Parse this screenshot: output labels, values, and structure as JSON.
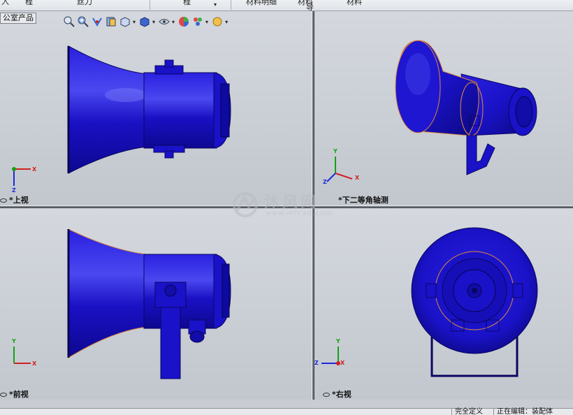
{
  "toolbar_top": {
    "items": [
      "入",
      "程",
      "丝刀",
      "程",
      "材料明细",
      "材料",
      "导",
      "材料"
    ]
  },
  "breadcrumb": "公室产品",
  "hud_icons": [
    "zoom-to-fit-icon",
    "zoom-area-icon",
    "previous-view-icon",
    "section-view-icon",
    "view-orientation-icon",
    "display-style-icon",
    "hide-show-icon",
    "edit-appearance-icon",
    "apply-scene-icon",
    "view-settings-icon"
  ],
  "views": {
    "top_left": "*上视",
    "top_right": "*下二等角轴测",
    "bottom_left": "*前视",
    "bottom_right": "*右视"
  },
  "axes": {
    "x": "X",
    "y": "Y",
    "z": "Z"
  },
  "watermark": {
    "text": "沐风网",
    "url": "www.mfcad.com"
  },
  "statusbar": {
    "defined": "完全定义",
    "editing": "正在编辑：装配体"
  },
  "colors": {
    "model_blue": "#1a12c8",
    "edge_orange": "#e08a3a",
    "axis_red": "#d22020",
    "axis_green": "#15a015",
    "axis_blue": "#1c2bd8"
  }
}
